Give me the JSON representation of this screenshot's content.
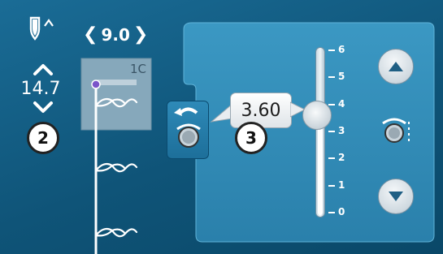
{
  "header": {
    "stitch_number": "9.0"
  },
  "length": {
    "value": "14.7"
  },
  "stitch_preview": {
    "label": "1C"
  },
  "badges": {
    "left": "2",
    "right": "3"
  },
  "tension": {
    "value": "3.60",
    "slider_min": 0,
    "slider_max": 6,
    "slider_level": 3.6,
    "ticks": [
      "6",
      "5",
      "4",
      "3",
      "2",
      "1",
      "0"
    ]
  },
  "icons": {
    "needle": "needle-icon",
    "up": "triangle-up-icon",
    "down": "triangle-down-icon",
    "tension": "thread-tension-icon"
  },
  "colors": {
    "background": "#135f86",
    "panel": "#2f8ab5",
    "accent": "#ffffff"
  }
}
